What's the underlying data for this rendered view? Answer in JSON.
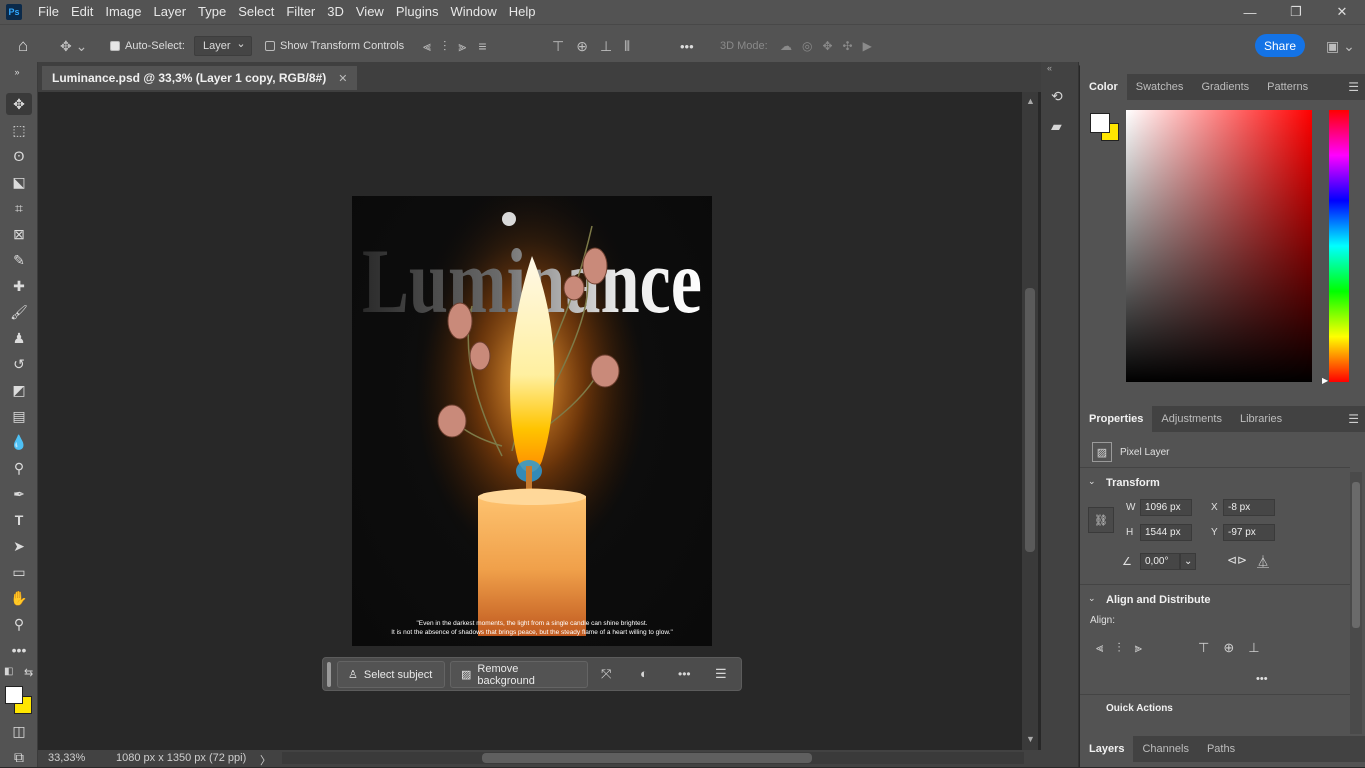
{
  "app": {
    "logo": "Ps"
  },
  "menu": [
    "File",
    "Edit",
    "Image",
    "Layer",
    "Type",
    "Select",
    "Filter",
    "3D",
    "View",
    "Plugins",
    "Window",
    "Help"
  ],
  "window_controls": {
    "minimize": "—",
    "restore": "❐",
    "close": "✕"
  },
  "options": {
    "auto_select_label": "Auto-Select:",
    "auto_select_value": "Layer",
    "show_transform_label": "Show Transform Controls",
    "mode_3d_label": "3D Mode:",
    "more": "•••",
    "share_label": "Share"
  },
  "document": {
    "tab_title": "Luminance.psd @ 33,3% (Layer 1 copy, RGB/8#)",
    "close": "✕"
  },
  "artwork": {
    "title": "Luminance",
    "quote_line1": "\"Even in the darkest moments, the light from a single candle can shine brightest.",
    "quote_line2": "It is not the absence of shadows that brings peace, but the steady flame of a heart willing to glow.\""
  },
  "context_bar": {
    "select_subject": "Select subject",
    "remove_background": "Remove background",
    "more": "•••"
  },
  "status": {
    "zoom": "33,33%",
    "doc_info": "1080 px x 1350 px (72 ppi)",
    "arrow": "〉"
  },
  "color_panel": {
    "tabs": [
      "Color",
      "Swatches",
      "Gradients",
      "Patterns"
    ],
    "foreground": "#ffffff",
    "background": "#ffe600",
    "hue_color": "#ff0000"
  },
  "properties_panel": {
    "tabs": [
      "Properties",
      "Adjustments",
      "Libraries"
    ],
    "layer_type": "Pixel Layer",
    "transform_title": "Transform",
    "w_label": "W",
    "w_value": "1096 px",
    "h_label": "H",
    "h_value": "1544 px",
    "x_label": "X",
    "x_value": "-8 px",
    "y_label": "Y",
    "y_value": "-97 px",
    "angle_value": "0,00°",
    "align_title": "Align and Distribute",
    "align_label": "Align:",
    "more": "•••",
    "quick_actions": "Quick Actions"
  },
  "layers_panel": {
    "tabs": [
      "Layers",
      "Channels",
      "Paths"
    ]
  }
}
